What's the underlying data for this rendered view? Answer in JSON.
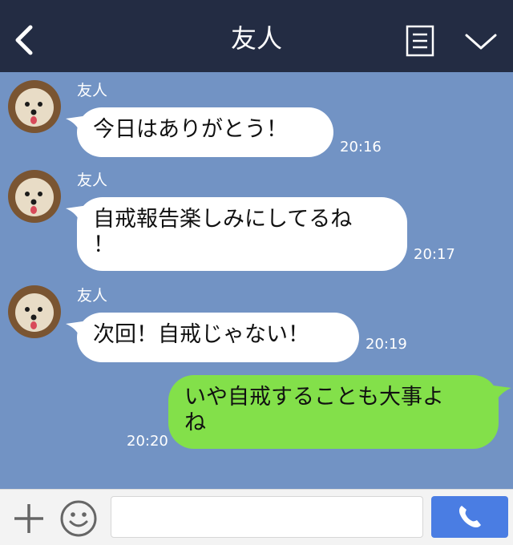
{
  "header": {
    "title": "友人",
    "back_icon": "chevron-left-icon",
    "notes_icon": "notes-icon",
    "menu_icon": "chevron-down-icon",
    "background": "#232c43"
  },
  "messages": [
    {
      "direction": "in",
      "sender": "友人",
      "text": "今日はありがとう！",
      "time": "20:16"
    },
    {
      "direction": "in",
      "sender": "友人",
      "text": "自戒報告楽しみにしてるね\n！",
      "time": "20:17"
    },
    {
      "direction": "in",
      "sender": "友人",
      "text": "次回！自戒じゃない！",
      "time": "20:19"
    },
    {
      "direction": "out",
      "text": "いや自戒することも大事よ\nね",
      "time": "20:20"
    }
  ],
  "input": {
    "plus_icon": "plus-icon",
    "emoji_icon": "smiley-icon",
    "value": "",
    "call_icon": "phone-icon"
  },
  "colors": {
    "chat_background": "#7293c4",
    "incoming_bubble": "#ffffff",
    "outgoing_bubble": "#83e04a",
    "call_button": "#4a7de3"
  }
}
